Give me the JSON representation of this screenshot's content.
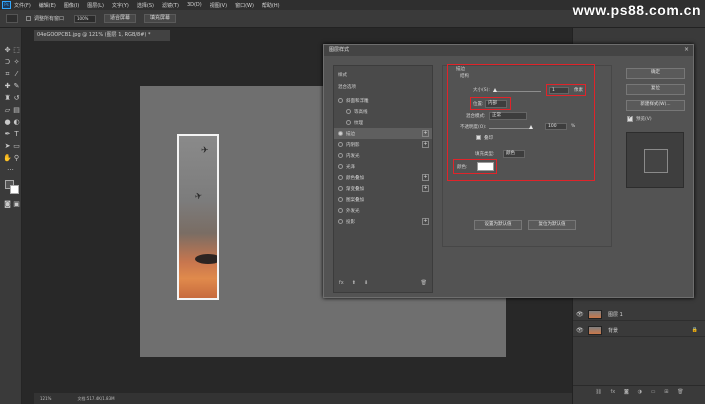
{
  "menubar": {
    "logo": "Ps",
    "items": [
      "文件(F)",
      "编辑(E)",
      "图像(I)",
      "图层(L)",
      "文字(Y)",
      "选择(S)",
      "滤镜(T)",
      "3D(D)",
      "视图(V)",
      "窗口(W)",
      "帮助(H)"
    ]
  },
  "watermark": "www.ps88.com.cn",
  "optbar": {
    "check_label": "调整所有窗口",
    "zoom": "100%",
    "fit_btn": "适合屏幕",
    "fill_btn": "填充屏幕"
  },
  "document": {
    "tab_title": "04eGOOPCB1.jpg @ 121% (图层 1, RGB/8#) *",
    "status_zoom": "121%",
    "status_doc": "文档:517.4K/1.83M"
  },
  "layers": [
    {
      "name": "图层 1",
      "visible": true
    },
    {
      "name": "背景",
      "visible": true,
      "locked": true
    }
  ],
  "dialog": {
    "title": "图层样式",
    "close": "×",
    "list_header_styles": "样式",
    "list_header_blend": "混合选项",
    "styles": [
      {
        "label": "斜面和浮雕",
        "checked": false,
        "plus": false,
        "indent": false
      },
      {
        "label": "等高线",
        "checked": false,
        "plus": false,
        "indent": true
      },
      {
        "label": "纹理",
        "checked": false,
        "plus": false,
        "indent": true
      },
      {
        "label": "描边",
        "checked": true,
        "plus": true,
        "indent": false,
        "active": true
      },
      {
        "label": "内阴影",
        "checked": false,
        "plus": true,
        "indent": false
      },
      {
        "label": "内发光",
        "checked": false,
        "plus": false,
        "indent": false
      },
      {
        "label": "光泽",
        "checked": false,
        "plus": false,
        "indent": false
      },
      {
        "label": "颜色叠加",
        "checked": false,
        "plus": true,
        "indent": false
      },
      {
        "label": "渐变叠加",
        "checked": false,
        "plus": true,
        "indent": false
      },
      {
        "label": "图案叠加",
        "checked": false,
        "plus": false,
        "indent": false
      },
      {
        "label": "外发光",
        "checked": false,
        "plus": false,
        "indent": false
      },
      {
        "label": "投影",
        "checked": false,
        "plus": true,
        "indent": false
      }
    ],
    "list_footer": "fx",
    "section_title": "描边",
    "section_sub": "结构",
    "size_label": "大小(S):",
    "size_value": "1",
    "size_unit": "像素",
    "position_label": "位置:",
    "position_value": "内部",
    "blend_label": "混合模式:",
    "blend_value": "正常",
    "opacity_label": "不透明度(O):",
    "opacity_value": "100",
    "opacity_unit": "%",
    "overprint_label": "叠印",
    "fill_type_label": "填充类型:",
    "fill_type_value": "颜色",
    "color_label": "颜色:",
    "stroke_color": "#ffffff",
    "set_default_btn": "设置为默认值",
    "reset_default_btn": "复位为默认值",
    "ok_btn": "确定",
    "cancel_btn": "复位",
    "new_style_btn": "新建样式(W)...",
    "preview_label": "预览(V)"
  }
}
